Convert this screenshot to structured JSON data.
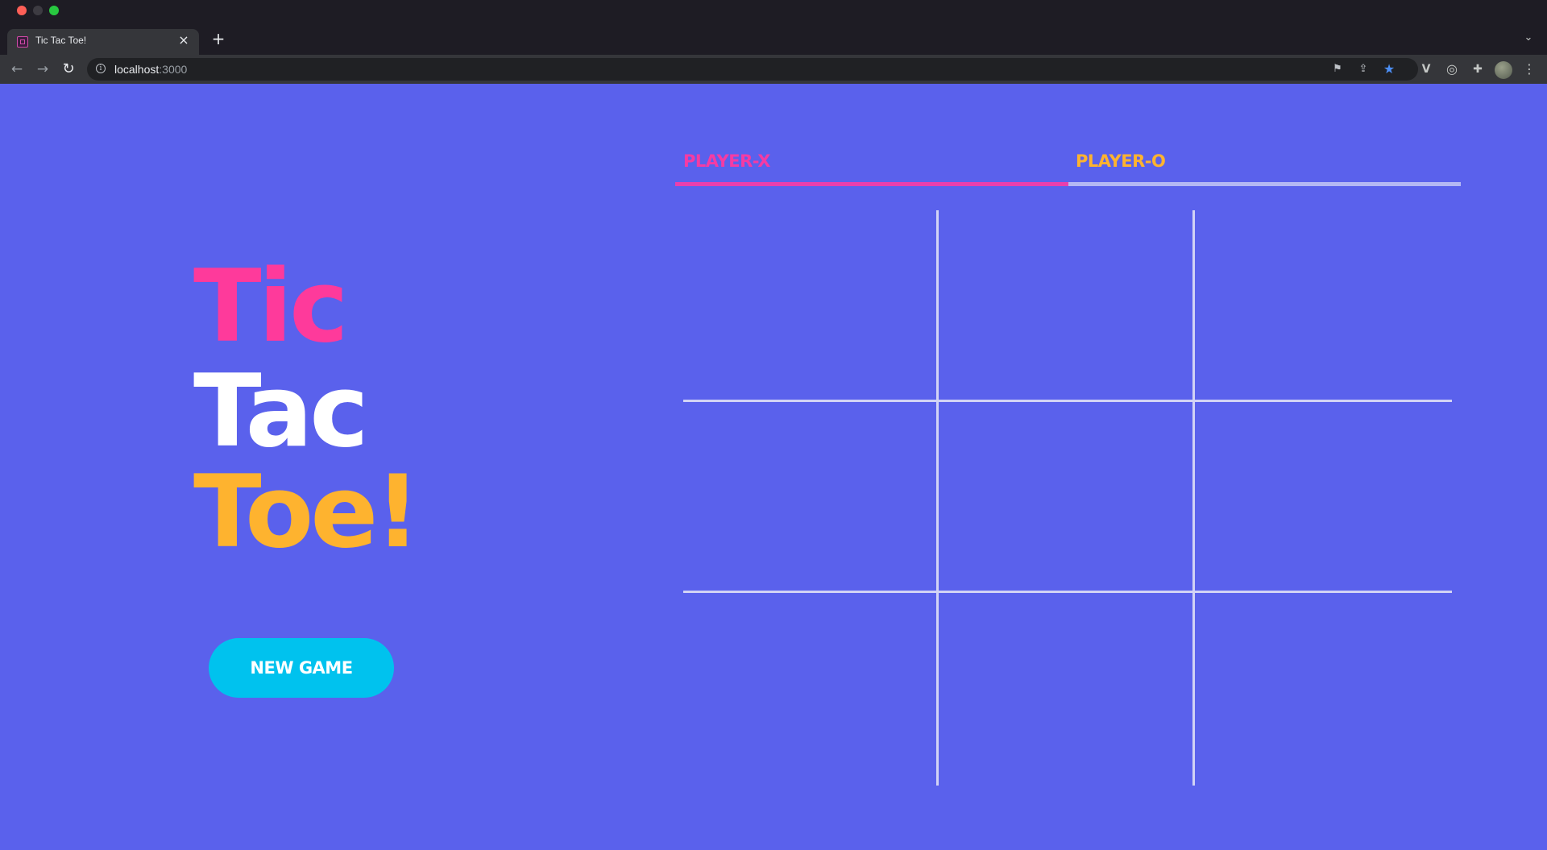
{
  "browser": {
    "tab_title": "Tic Tac Toe!",
    "tab_close": "×",
    "new_tab": "+",
    "tab_dropdown": "⌄",
    "url_host": "localhost",
    "url_port": ":3000",
    "icons": [
      "back-arrow-icon",
      "forward-arrow-icon",
      "reload-icon",
      "info-icon",
      "translate-icon",
      "share-icon",
      "bookmark-star-icon",
      "vue-devtools-icon",
      "target-extension-icon",
      "extensions-puzzle-icon",
      "profile-avatar",
      "menu-dots-icon"
    ]
  },
  "game": {
    "title_line1": "Tic",
    "title_line2": "Tac",
    "title_line3": "Toe!",
    "new_game_label": "NEW GAME",
    "player_x_label": "PLAYER-X",
    "player_o_label": "PLAYER-O",
    "turn_progress": 0.5,
    "board": [
      "",
      "",
      "",
      "",
      "",
      "",
      "",
      "",
      ""
    ]
  },
  "colors": {
    "background": "#5a61ec",
    "pink": "#fe3a9b",
    "orange": "#feb32f",
    "cyan_button": "#00c2ee",
    "grid_line": "#d2d3f5"
  }
}
